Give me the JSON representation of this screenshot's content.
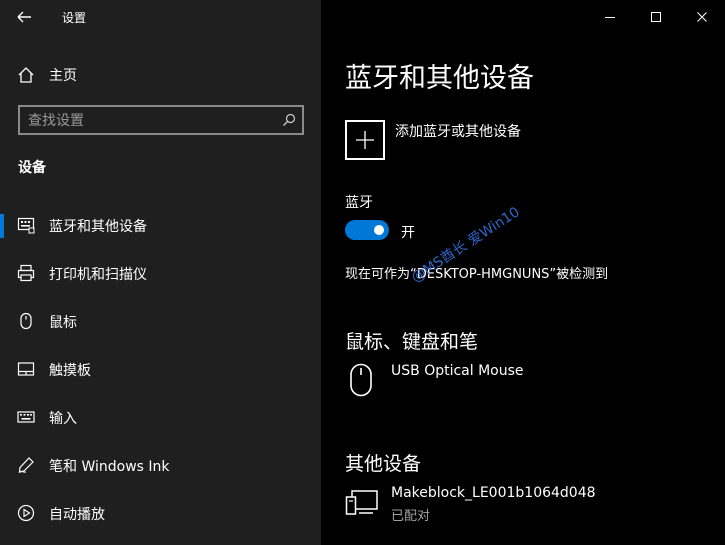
{
  "window": {
    "title": "设置",
    "controls": [
      "minimize-icon",
      "maximize-icon",
      "close-icon"
    ]
  },
  "sidebar": {
    "home_label": "主页",
    "search": {
      "placeholder": "查找设置",
      "value": ""
    },
    "section_title": "设备",
    "items": [
      {
        "label": "蓝牙和其他设备",
        "icon": "bluetooth-devices-icon",
        "selected": true
      },
      {
        "label": "打印机和扫描仪",
        "icon": "printer-icon",
        "selected": false
      },
      {
        "label": "鼠标",
        "icon": "mouse-icon",
        "selected": false
      },
      {
        "label": "触摸板",
        "icon": "touchpad-icon",
        "selected": false
      },
      {
        "label": "输入",
        "icon": "keyboard-icon",
        "selected": false
      },
      {
        "label": "笔和 Windows Ink",
        "icon": "pen-icon",
        "selected": false
      },
      {
        "label": "自动播放",
        "icon": "autoplay-icon",
        "selected": false
      }
    ]
  },
  "main": {
    "title": "蓝牙和其他设备",
    "add_device_label": "添加蓝牙或其他设备",
    "bluetooth_label": "蓝牙",
    "bluetooth_state": "开",
    "bluetooth_on": true,
    "discoverable_text": "现在可作为“DESKTOP-HMGNUNS”被检测到",
    "watermark": "@MS酋长 爱Win10",
    "mouse_section": {
      "heading": "鼠标、键盘和笔",
      "devices": [
        {
          "name": "USB Optical Mouse"
        }
      ]
    },
    "other_section": {
      "heading": "其他设备",
      "devices": [
        {
          "name": "Makeblock_LE001b1064d048",
          "status": "已配对"
        }
      ]
    }
  },
  "colors": {
    "accent": "#0078d7",
    "sidebar_bg": "#1f1f1f",
    "main_bg": "#000000",
    "secondary_text": "#a0a0a0",
    "watermark": "#2f66c9"
  }
}
